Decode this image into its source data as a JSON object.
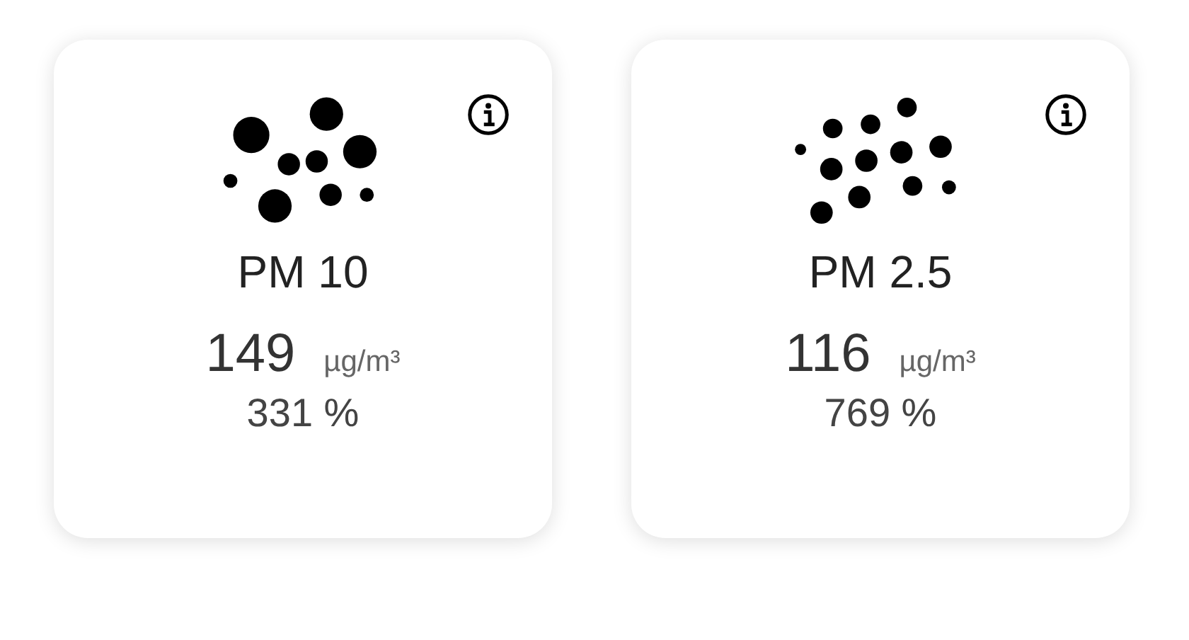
{
  "cards": [
    {
      "kind": "coarse",
      "title": "PM 10",
      "value": "149",
      "unit": "µg/m³",
      "percent": "331 %"
    },
    {
      "kind": "fine",
      "title": "PM 2.5",
      "value": "116",
      "unit": "µg/m³",
      "percent": "769 %"
    }
  ]
}
